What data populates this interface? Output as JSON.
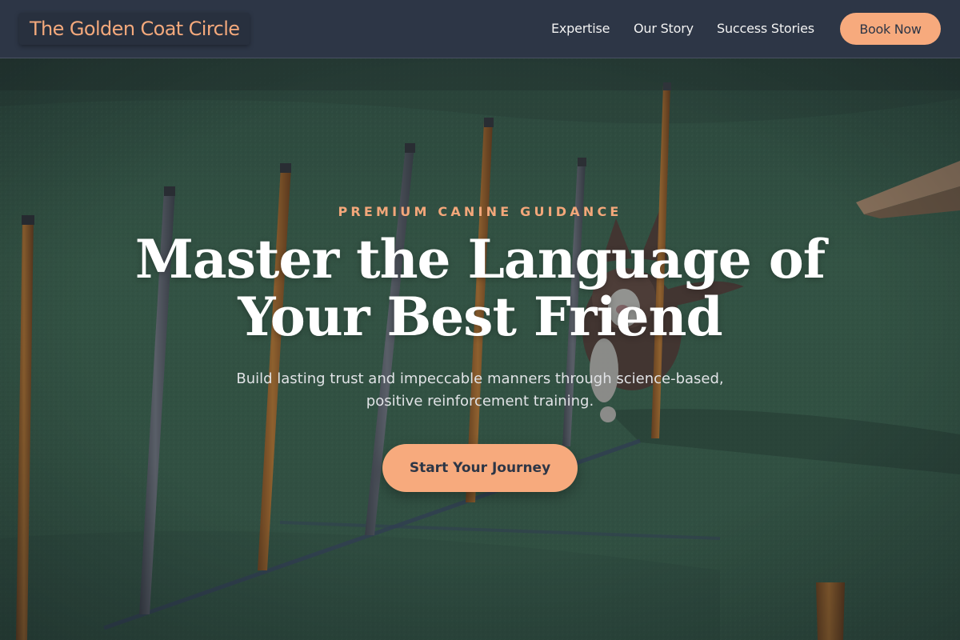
{
  "header": {
    "brand": "The Golden Coat Circle",
    "nav": {
      "expertise": "Expertise",
      "story": "Our Story",
      "success": "Success Stories"
    },
    "book_label": "Book Now"
  },
  "hero": {
    "eyebrow": "PREMIUM CANINE GUIDANCE",
    "headline_line1": "Master the Language of",
    "headline_line2": "Your Best Friend",
    "subtitle_line1": "Build lasting trust and impeccable manners through science-based,",
    "subtitle_line2": "positive reinforcement training.",
    "cta_label": "Start Your Journey"
  },
  "colors": {
    "nav_background": "#2d3646",
    "accent": "#f7aa7d",
    "turf": "#3f6b4b",
    "heading": "#ffffff"
  },
  "icons": {
    "background": "agility-dog-weave-poles-photo"
  }
}
